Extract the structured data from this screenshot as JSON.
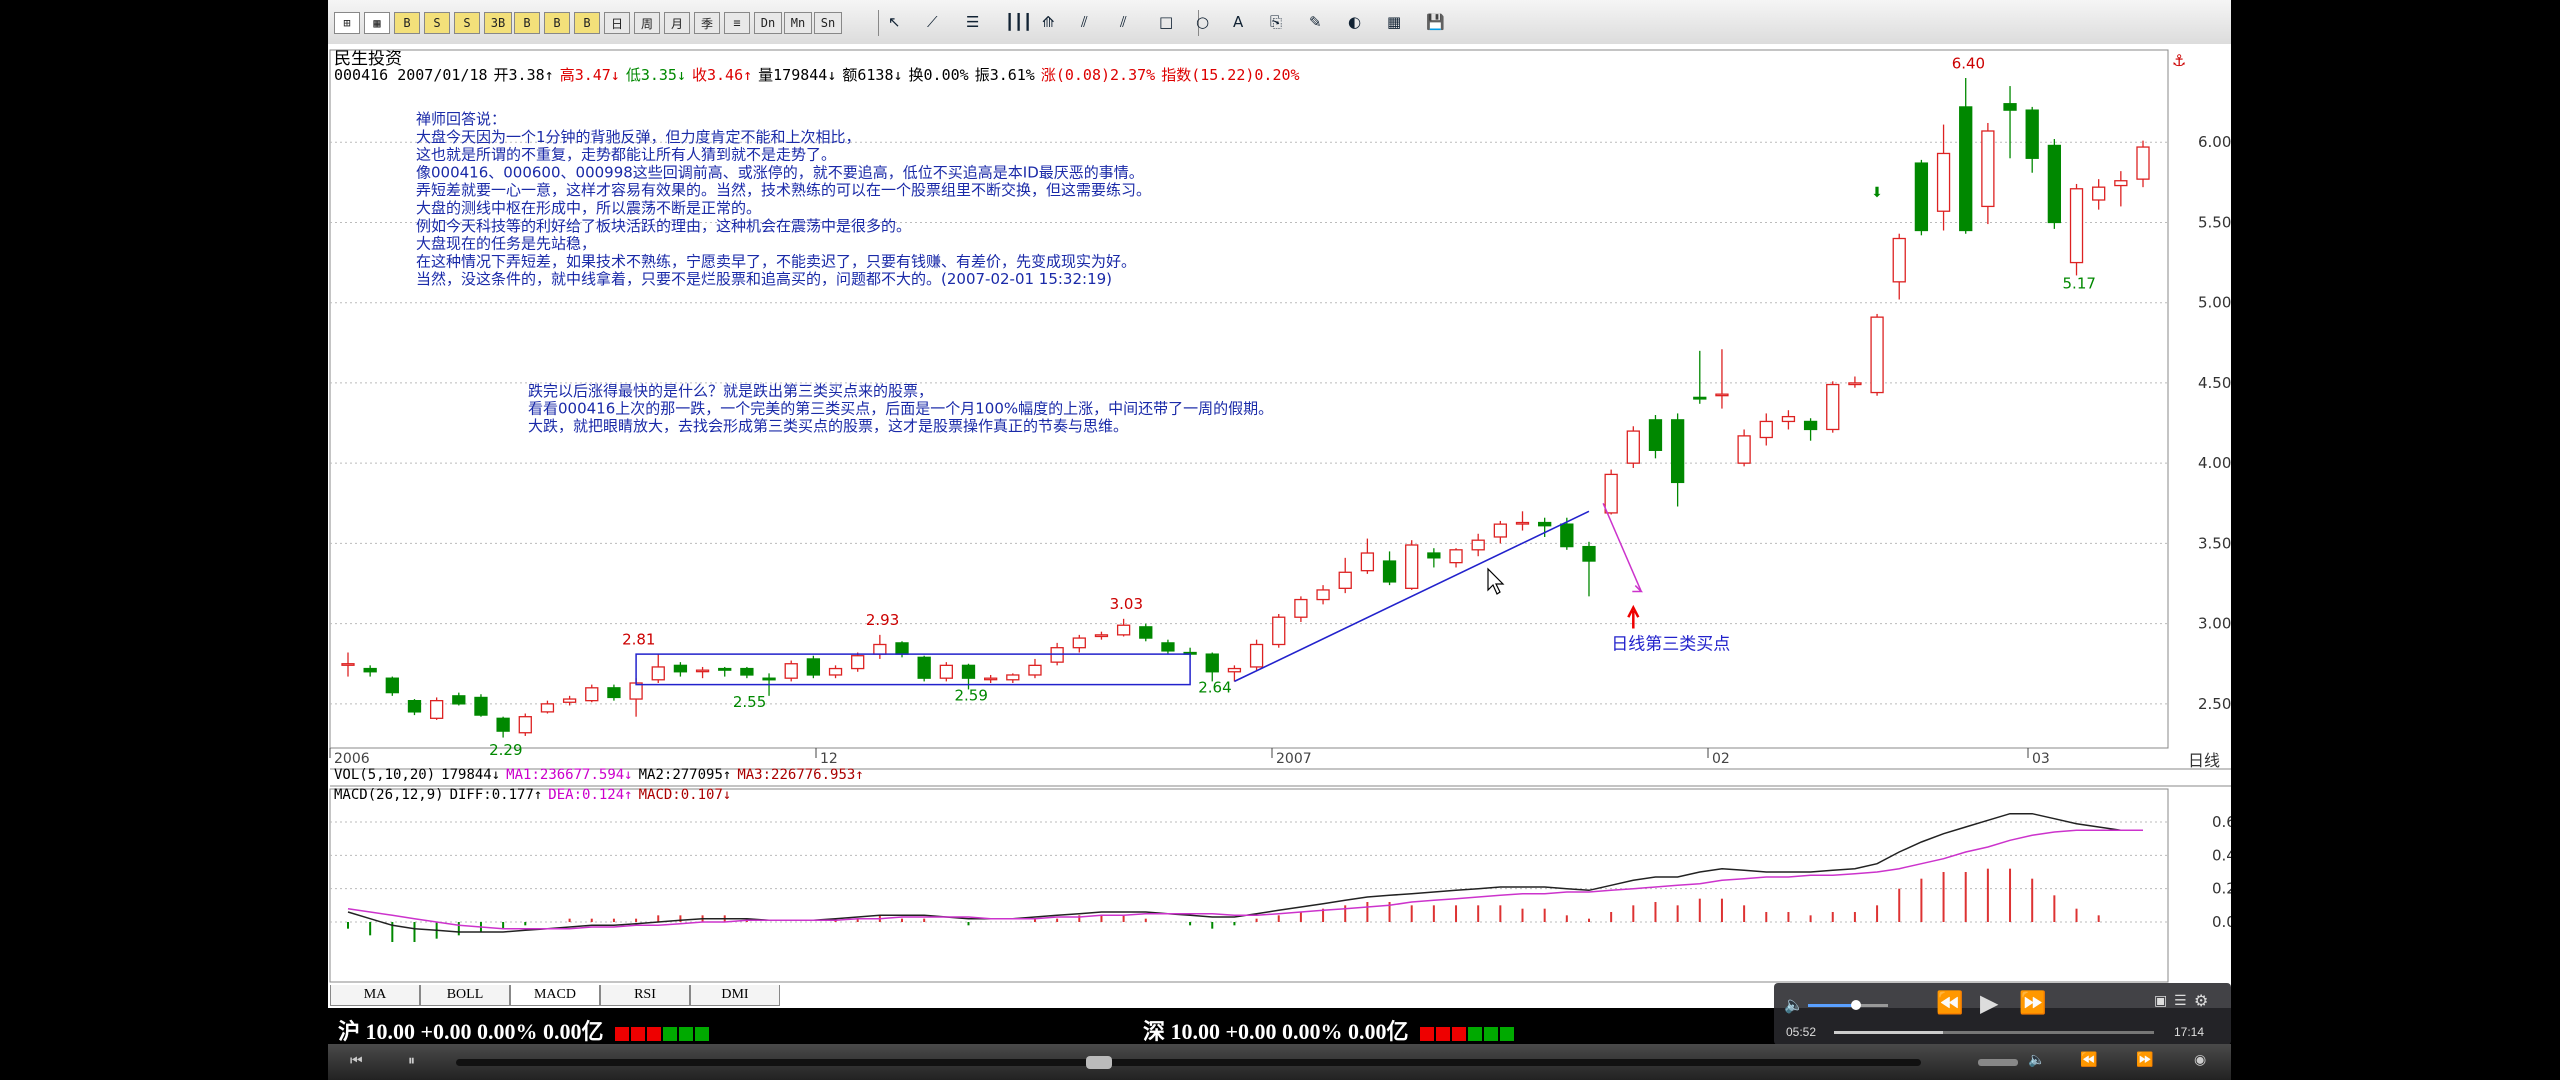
{
  "toolbar": {
    "buttons": [
      "⊞",
      "▦",
      "B",
      "S",
      "S",
      "3B",
      "B",
      "B",
      "B",
      "日",
      "周",
      "月",
      "季",
      "≡",
      "Dn",
      "Mn",
      "Sn"
    ]
  },
  "stock": {
    "name": "民生投资",
    "info": [
      {
        "t": "000416 2007/01/18",
        "c": "#000"
      },
      {
        "t": "开3.38↑",
        "c": "#000"
      },
      {
        "t": "高3.47↓",
        "c": "#d00"
      },
      {
        "t": "低3.35↓",
        "c": "#080"
      },
      {
        "t": "收3.46↑",
        "c": "#d00"
      },
      {
        "t": "量179844↓",
        "c": "#000"
      },
      {
        "t": "额6138↓",
        "c": "#000"
      },
      {
        "t": "换0.00%",
        "c": "#000"
      },
      {
        "t": "振3.61%",
        "c": "#000"
      },
      {
        "t": "涨(0.08)2.37%",
        "c": "#d00"
      },
      {
        "t": "指数(15.22)0.20%",
        "c": "#d00"
      }
    ]
  },
  "annotations": {
    "note1": [
      "禅师回答说：",
      "大盘今天因为一个1分钟的背驰反弹，但力度肯定不能和上次相比，",
      "这也就是所谓的不重复，走势都能让所有人猜到就不是走势了。",
      "像000416、000600、000998这些回调前高、或涨停的，就不要追高，低位不买追高是本ID最厌恶的事情。",
      "弄短差就要一心一意，这样才容易有效果的。当然，技术熟练的可以在一个股票组里不断交换，但这需要练习。",
      "大盘的测线中枢在形成中，所以震荡不断是正常的。",
      "例如今天科技等的利好给了板块活跃的理由，这种机会在震荡中是很多的。",
      "大盘现在的任务是先站稳，",
      "在这种情况下弄短差，如果技术不熟练，宁愿卖早了，不能卖迟了，只要有钱赚、有差价，先变成现实为好。",
      "当然，没这条件的，就中线拿着，只要不是烂股票和追高买的，问题都不大的。(2007-02-01 15:32:19)"
    ],
    "note2": [
      "跌完以后涨得最快的是什么？就是跌出第三类买点来的股票，",
      "看看000416上次的那一跌，一个完美的第三类买点，后面是一个月100%幅度的上涨，中间还带了一周的假期。",
      "大跌，就把眼睛放大，去找会形成第三类买点的股票，这才是股票操作真正的节奏与思维。"
    ],
    "buy_point_label": "日线第三类买点"
  },
  "price_labels": [
    "2.29",
    "2.81",
    "2.55",
    "2.93",
    "2.59",
    "3.03",
    "2.64",
    "6.40",
    "5.17"
  ],
  "axis": {
    "y": [
      "6.00",
      "5.50",
      "5.00",
      "4.50",
      "4.00",
      "3.50",
      "3.00",
      "2.50"
    ],
    "x": [
      "2006",
      "12",
      "2007",
      "02",
      "03"
    ],
    "corner": "日线",
    "macd_y": [
      "0.60",
      "0.40",
      "0.20",
      "0.00"
    ]
  },
  "indicators": {
    "vol": [
      {
        "t": "VOL(5,10,20)",
        "c": "#000"
      },
      {
        "t": "179844↓",
        "c": "#000"
      },
      {
        "t": "MA1:236677.594↓",
        "c": "#c0c"
      },
      {
        "t": "MA2:277095↑",
        "c": "#000"
      },
      {
        "t": "MA3:226776.953↑",
        "c": "#a00"
      }
    ],
    "macd": [
      {
        "t": "MACD(26,12,9)",
        "c": "#000"
      },
      {
        "t": "DIFF:0.177↑",
        "c": "#000"
      },
      {
        "t": "DEA:0.124↑",
        "c": "#c0c"
      },
      {
        "t": "MACD:0.107↓",
        "c": "#a00"
      }
    ]
  },
  "tabs": [
    "MA",
    "BOLL",
    "MACD",
    "RSI",
    "DMI"
  ],
  "status": {
    "sh_prefix": "沪",
    "sh_values": "10.00 +0.00 0.00% 0.00亿",
    "sz_prefix": "深",
    "sz_values": "10.00 +0.00 0.00% 0.00亿"
  },
  "player": {
    "elapsed": "05:52",
    "total": "17:14",
    "progress": 0.34,
    "volume": 0.6,
    "timeline": 0.43
  },
  "chart_data": {
    "type": "candlestick",
    "symbol": "000416",
    "ylim": [
      2.2,
      6.5
    ],
    "y_ticks": [
      2.5,
      3.0,
      3.5,
      4.0,
      4.5,
      5.0,
      5.5,
      6.0
    ],
    "x_labels": [
      "2006",
      "12",
      "2007",
      "02",
      "03"
    ],
    "candles": [
      [
        2.75,
        2.75,
        2.67,
        2.82
      ],
      [
        2.72,
        2.7,
        2.67,
        2.74
      ],
      [
        2.66,
        2.57,
        2.55,
        2.67
      ],
      [
        2.52,
        2.45,
        2.43,
        2.53
      ],
      [
        2.41,
        2.52,
        2.4,
        2.54
      ],
      [
        2.55,
        2.5,
        2.49,
        2.57
      ],
      [
        2.54,
        2.43,
        2.42,
        2.56
      ],
      [
        2.41,
        2.33,
        2.29,
        2.42
      ],
      [
        2.32,
        2.42,
        2.3,
        2.44
      ],
      [
        2.45,
        2.5,
        2.44,
        2.52
      ],
      [
        2.51,
        2.53,
        2.49,
        2.55
      ],
      [
        2.52,
        2.6,
        2.51,
        2.62
      ],
      [
        2.6,
        2.54,
        2.52,
        2.62
      ],
      [
        2.53,
        2.63,
        2.42,
        2.66
      ],
      [
        2.65,
        2.73,
        2.63,
        2.81
      ],
      [
        2.74,
        2.7,
        2.67,
        2.76
      ],
      [
        2.71,
        2.71,
        2.66,
        2.73
      ],
      [
        2.72,
        2.71,
        2.67,
        2.73
      ],
      [
        2.72,
        2.68,
        2.66,
        2.73
      ],
      [
        2.66,
        2.65,
        2.55,
        2.69
      ],
      [
        2.66,
        2.75,
        2.64,
        2.77
      ],
      [
        2.78,
        2.68,
        2.66,
        2.8
      ],
      [
        2.68,
        2.72,
        2.66,
        2.74
      ],
      [
        2.72,
        2.8,
        2.7,
        2.82
      ],
      [
        2.81,
        2.87,
        2.78,
        2.93
      ],
      [
        2.88,
        2.81,
        2.79,
        2.89
      ],
      [
        2.79,
        2.66,
        2.64,
        2.8
      ],
      [
        2.66,
        2.74,
        2.64,
        2.76
      ],
      [
        2.74,
        2.66,
        2.59,
        2.75
      ],
      [
        2.66,
        2.66,
        2.63,
        2.68
      ],
      [
        2.65,
        2.68,
        2.63,
        2.69
      ],
      [
        2.68,
        2.74,
        2.66,
        2.78
      ],
      [
        2.76,
        2.85,
        2.74,
        2.88
      ],
      [
        2.85,
        2.91,
        2.82,
        2.93
      ],
      [
        2.92,
        2.93,
        2.9,
        2.95
      ],
      [
        2.93,
        2.99,
        2.92,
        3.03
      ],
      [
        2.98,
        2.91,
        2.89,
        3.0
      ],
      [
        2.88,
        2.83,
        2.81,
        2.9
      ],
      [
        2.82,
        2.81,
        2.79,
        2.85
      ],
      [
        2.81,
        2.7,
        2.64,
        2.82
      ],
      [
        2.7,
        2.72,
        2.64,
        2.74
      ],
      [
        2.73,
        2.87,
        2.71,
        2.9
      ],
      [
        2.87,
        3.04,
        2.85,
        3.06
      ],
      [
        3.04,
        3.15,
        3.01,
        3.17
      ],
      [
        3.15,
        3.21,
        3.12,
        3.24
      ],
      [
        3.22,
        3.32,
        3.19,
        3.41
      ],
      [
        3.33,
        3.44,
        3.31,
        3.53
      ],
      [
        3.39,
        3.26,
        3.24,
        3.45
      ],
      [
        3.22,
        3.49,
        3.21,
        3.52
      ],
      [
        3.44,
        3.41,
        3.35,
        3.47
      ],
      [
        3.38,
        3.46,
        3.35,
        3.47
      ],
      [
        3.46,
        3.52,
        3.42,
        3.56
      ],
      [
        3.54,
        3.62,
        3.5,
        3.64
      ],
      [
        3.63,
        3.63,
        3.58,
        3.7
      ],
      [
        3.63,
        3.61,
        3.54,
        3.66
      ],
      [
        3.62,
        3.48,
        3.46,
        3.66
      ],
      [
        3.48,
        3.39,
        3.17,
        3.51
      ],
      [
        3.69,
        3.93,
        3.68,
        3.96
      ],
      [
        4.0,
        4.2,
        3.97,
        4.23
      ],
      [
        4.27,
        4.08,
        4.03,
        4.3
      ],
      [
        4.27,
        3.88,
        3.73,
        4.31
      ],
      [
        4.41,
        4.4,
        4.37,
        4.7
      ],
      [
        4.43,
        4.43,
        4.34,
        4.71
      ],
      [
        4.0,
        4.17,
        3.98,
        4.21
      ],
      [
        4.16,
        4.26,
        4.11,
        4.31
      ],
      [
        4.26,
        4.29,
        4.21,
        4.33
      ],
      [
        4.26,
        4.21,
        4.14,
        4.28
      ],
      [
        4.21,
        4.49,
        4.19,
        4.51
      ],
      [
        4.49,
        4.5,
        4.47,
        4.54
      ],
      [
        4.44,
        4.91,
        4.42,
        4.93
      ],
      [
        5.13,
        5.4,
        5.02,
        5.43
      ],
      [
        5.87,
        5.45,
        5.42,
        5.89
      ],
      [
        5.57,
        5.93,
        5.45,
        6.11
      ],
      [
        6.22,
        5.45,
        5.43,
        6.4
      ],
      [
        5.6,
        6.07,
        5.49,
        6.12
      ],
      [
        6.24,
        6.2,
        5.9,
        6.35
      ],
      [
        6.2,
        5.9,
        5.81,
        6.22
      ],
      [
        5.98,
        5.5,
        5.46,
        6.02
      ],
      [
        5.25,
        5.71,
        5.17,
        5.74
      ],
      [
        5.64,
        5.72,
        5.58,
        5.77
      ],
      [
        5.73,
        5.76,
        5.6,
        5.82
      ],
      [
        5.77,
        5.97,
        5.72,
        6.01
      ]
    ],
    "channel": [
      [
        2.62,
        2.62
      ],
      [
        2.81,
        2.81
      ]
    ],
    "trend_line": [
      2.64,
      3.7
    ],
    "macd": {
      "diff": [
        0.06,
        0.02,
        -0.02,
        -0.04,
        -0.05,
        -0.06,
        -0.06,
        -0.06,
        -0.05,
        -0.04,
        -0.03,
        -0.02,
        -0.02,
        -0.01,
        0.0,
        0.01,
        0.02,
        0.02,
        0.02,
        0.01,
        0.01,
        0.01,
        0.02,
        0.03,
        0.04,
        0.04,
        0.04,
        0.03,
        0.02,
        0.02,
        0.02,
        0.03,
        0.04,
        0.05,
        0.06,
        0.06,
        0.06,
        0.05,
        0.04,
        0.03,
        0.03,
        0.05,
        0.07,
        0.09,
        0.11,
        0.13,
        0.15,
        0.16,
        0.17,
        0.18,
        0.19,
        0.2,
        0.21,
        0.21,
        0.21,
        0.2,
        0.19,
        0.22,
        0.25,
        0.27,
        0.27,
        0.3,
        0.32,
        0.31,
        0.3,
        0.3,
        0.3,
        0.31,
        0.32,
        0.35,
        0.42,
        0.48,
        0.53,
        0.57,
        0.61,
        0.65,
        0.65,
        0.62,
        0.59,
        0.57,
        0.55,
        0.55
      ],
      "dea": [
        0.08,
        0.06,
        0.04,
        0.02,
        0.0,
        -0.02,
        -0.03,
        -0.04,
        -0.04,
        -0.04,
        -0.04,
        -0.03,
        -0.03,
        -0.02,
        -0.02,
        -0.01,
        0.0,
        0.0,
        0.01,
        0.01,
        0.01,
        0.01,
        0.01,
        0.02,
        0.02,
        0.03,
        0.03,
        0.03,
        0.03,
        0.02,
        0.02,
        0.02,
        0.03,
        0.03,
        0.04,
        0.04,
        0.05,
        0.05,
        0.05,
        0.05,
        0.04,
        0.04,
        0.05,
        0.06,
        0.07,
        0.08,
        0.09,
        0.1,
        0.12,
        0.13,
        0.14,
        0.15,
        0.16,
        0.17,
        0.17,
        0.18,
        0.18,
        0.19,
        0.2,
        0.21,
        0.22,
        0.23,
        0.25,
        0.26,
        0.27,
        0.27,
        0.28,
        0.28,
        0.29,
        0.3,
        0.32,
        0.35,
        0.38,
        0.42,
        0.45,
        0.49,
        0.52,
        0.54,
        0.55,
        0.55,
        0.55,
        0.55
      ]
    }
  }
}
